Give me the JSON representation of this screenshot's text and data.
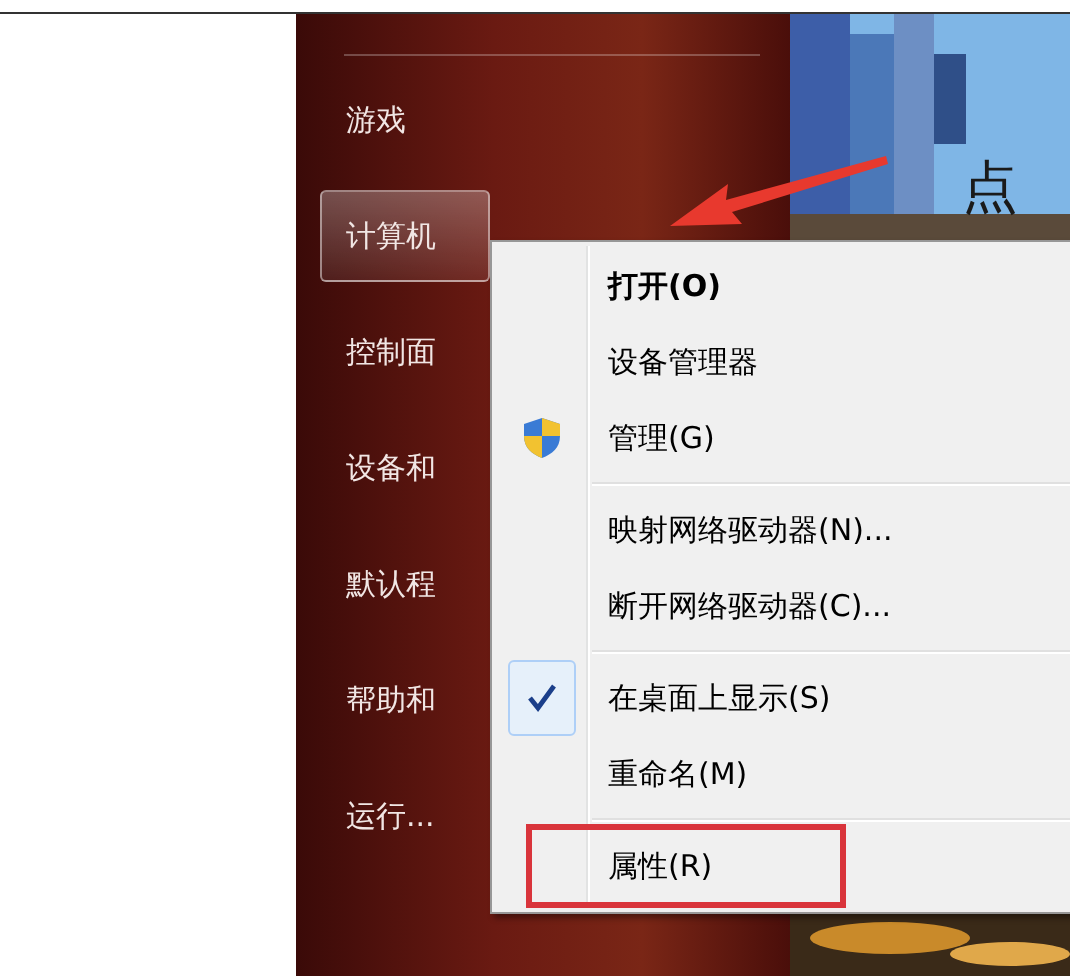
{
  "start_menu": {
    "items": [
      {
        "label": "游戏",
        "selected": false
      },
      {
        "label": "计算机",
        "selected": true
      },
      {
        "label": "控制面",
        "selected": false
      },
      {
        "label": "设备和",
        "selected": false
      },
      {
        "label": "默认程",
        "selected": false
      },
      {
        "label": "帮助和",
        "selected": false
      },
      {
        "label": "运行...",
        "selected": false
      }
    ]
  },
  "picture_caption": "点",
  "context_menu": {
    "items": [
      {
        "kind": "item",
        "label": "打开(O)",
        "default": true,
        "checked": false,
        "framed": false
      },
      {
        "kind": "item",
        "label": "设备管理器",
        "default": false,
        "checked": false,
        "framed": false
      },
      {
        "kind": "admin",
        "label": "管理(G)",
        "default": false,
        "checked": false,
        "framed": false
      },
      {
        "kind": "separator"
      },
      {
        "kind": "item",
        "label": "映射网络驱动器(N)...",
        "default": false,
        "checked": false,
        "framed": false
      },
      {
        "kind": "item",
        "label": "断开网络驱动器(C)...",
        "default": false,
        "checked": false,
        "framed": false
      },
      {
        "kind": "separator"
      },
      {
        "kind": "item",
        "label": "在桌面上显示(S)",
        "default": false,
        "checked": true,
        "framed": false
      },
      {
        "kind": "item",
        "label": "重命名(M)",
        "default": false,
        "checked": false,
        "framed": false
      },
      {
        "kind": "separator"
      },
      {
        "kind": "item",
        "label": "属性(R)",
        "default": false,
        "checked": false,
        "framed": true
      }
    ]
  }
}
